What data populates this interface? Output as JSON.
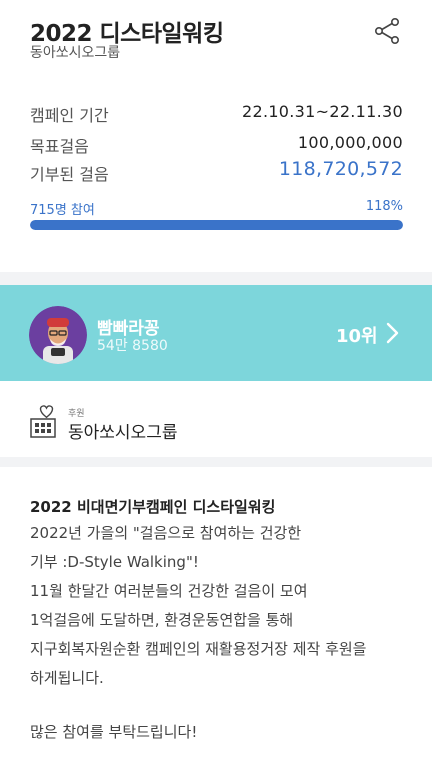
{
  "campaign": {
    "title": "2022 디스타일워킹",
    "organizer": "동아쏘시오그룹"
  },
  "icons": {
    "share": "share-icon",
    "chevron": "chevron-right-icon",
    "sponsor": "building-heart-icon"
  },
  "stats": {
    "period_label": "캠페인 기간",
    "period_value": "22.10.31~22.11.30",
    "goal_label": "목표걸음",
    "goal_value": "100,000,000",
    "donated_label": "기부된 걸음",
    "donated_value": "118,720,572"
  },
  "progress": {
    "participants": "715명 참여",
    "percent_label": "118%",
    "percent": 118
  },
  "ranking": {
    "name": "빰빠라꽁",
    "steps": "54만 8580",
    "rank": "10위"
  },
  "sponsor": {
    "tag": "후원",
    "name": "동아쏘시오그룹"
  },
  "description": {
    "title": "2022 비대면기부캠페인 디스타일워킹",
    "lines": [
      "2022년 가을의 \"걸음으로 참여하는 건강한",
      "기부 :D-Style Walking\"!",
      "11월 한달간 여러분들의 건강한 걸음이 모여",
      "1억걸음에 도달하면, 환경운동연합을 통해",
      "지구회복자원순환 캠페인의 재활용정거장 제작 후원을",
      "하게됩니다.",
      "",
      "많은 참여를 부탁드립니다!"
    ]
  },
  "colors": {
    "accent": "#3a73c9",
    "rank_band": "#7dd6db",
    "bar_bg": "#e3e6ec"
  }
}
